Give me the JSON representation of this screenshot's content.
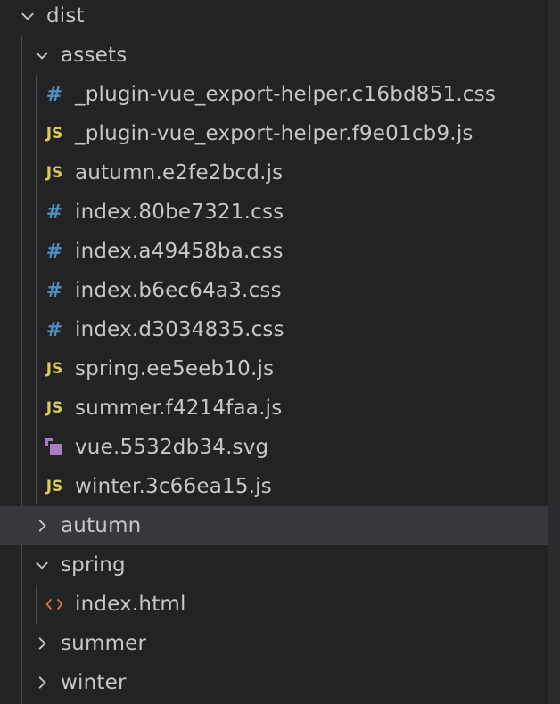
{
  "colors": {
    "background": "#232325",
    "selected_row": "#37373c",
    "text": "#c6c7c9",
    "css_icon": "#4f8fbf",
    "js_icon": "#d9cb58",
    "svg_icon": "#a77cc6",
    "html_icon": "#d4783c"
  },
  "tree": {
    "root": {
      "label": "dist",
      "expanded": true
    },
    "assets": {
      "label": "assets",
      "expanded": true,
      "files": [
        {
          "icon": "css",
          "glyph": "#",
          "label": "_plugin-vue_export-helper.c16bd851.css"
        },
        {
          "icon": "js",
          "glyph": "JS",
          "label": "_plugin-vue_export-helper.f9e01cb9.js"
        },
        {
          "icon": "js",
          "glyph": "JS",
          "label": "autumn.e2fe2bcd.js"
        },
        {
          "icon": "css",
          "glyph": "#",
          "label": "index.80be7321.css"
        },
        {
          "icon": "css",
          "glyph": "#",
          "label": "index.a49458ba.css"
        },
        {
          "icon": "css",
          "glyph": "#",
          "label": "index.b6ec64a3.css"
        },
        {
          "icon": "css",
          "glyph": "#",
          "label": "index.d3034835.css"
        },
        {
          "icon": "js",
          "glyph": "JS",
          "label": "spring.ee5eeb10.js"
        },
        {
          "icon": "js",
          "glyph": "JS",
          "label": "summer.f4214faa.js"
        },
        {
          "icon": "svg",
          "glyph": "",
          "label": "vue.5532db34.svg"
        },
        {
          "icon": "js",
          "glyph": "JS",
          "label": "winter.3c66ea15.js"
        }
      ]
    },
    "autumn": {
      "label": "autumn",
      "expanded": false,
      "selected": true
    },
    "spring": {
      "label": "spring",
      "expanded": true,
      "files": [
        {
          "icon": "html",
          "glyph": "<>",
          "label": "index.html"
        }
      ]
    },
    "summer": {
      "label": "summer",
      "expanded": false
    },
    "winter": {
      "label": "winter",
      "expanded": false
    }
  }
}
